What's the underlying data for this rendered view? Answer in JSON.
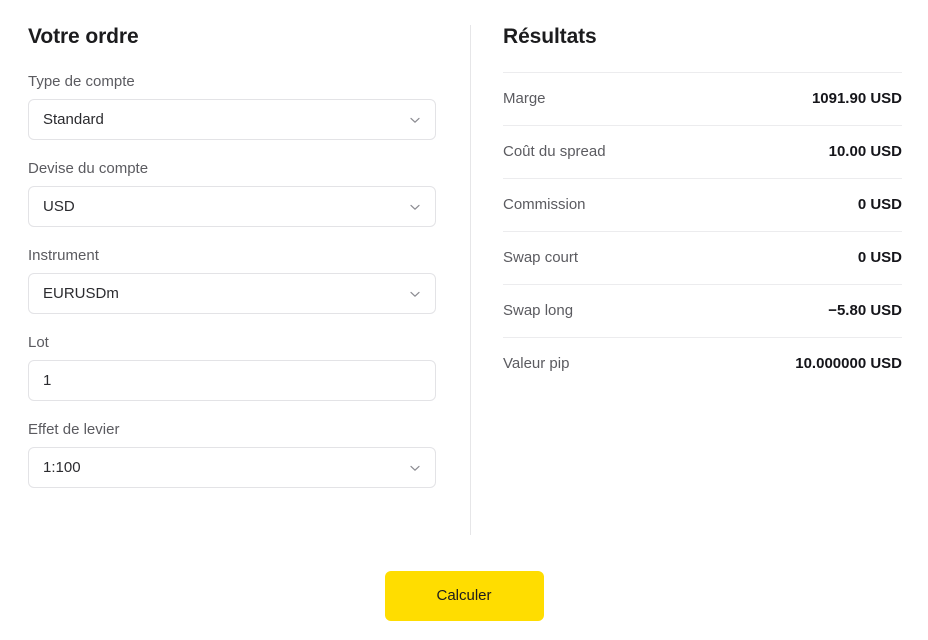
{
  "order_panel": {
    "title": "Votre ordre",
    "fields": [
      {
        "label": "Type de compte",
        "value": "Standard",
        "control": "select",
        "icon": "chevron-down-icon",
        "name": "account-type"
      },
      {
        "label": "Devise du compte",
        "value": "USD",
        "control": "select",
        "icon": "chevron-down-icon",
        "name": "account-currency"
      },
      {
        "label": "Instrument",
        "value": "EURUSDm",
        "control": "select",
        "icon": "chevron-down-icon",
        "name": "instrument"
      },
      {
        "label": "Lot",
        "value": "1",
        "control": "text",
        "icon": "",
        "name": "lot"
      },
      {
        "label": "Effet de levier",
        "value": "1:100",
        "control": "select",
        "icon": "chevron-down-icon",
        "name": "leverage"
      }
    ]
  },
  "results_panel": {
    "title": "Résultats",
    "rows": [
      {
        "label": "Marge",
        "value": "1091.90 USD",
        "name": "margin"
      },
      {
        "label": "Coût du spread",
        "value": "10.00 USD",
        "name": "spread-cost"
      },
      {
        "label": "Commission",
        "value": "0 USD",
        "name": "commission"
      },
      {
        "label": "Swap court",
        "value": "0 USD",
        "name": "swap-short"
      },
      {
        "label": "Swap long",
        "value": "−5.80 USD",
        "name": "swap-long"
      },
      {
        "label": "Valeur pip",
        "value": "10.000000 USD",
        "name": "pip-value"
      }
    ]
  },
  "actions": {
    "calculate_label": "Calculer"
  },
  "colors": {
    "accent": "#ffdd00",
    "text_primary": "#1c1c1e",
    "text_secondary": "#5b5b60",
    "border": "#e3e3e6",
    "divider": "#ececee"
  }
}
